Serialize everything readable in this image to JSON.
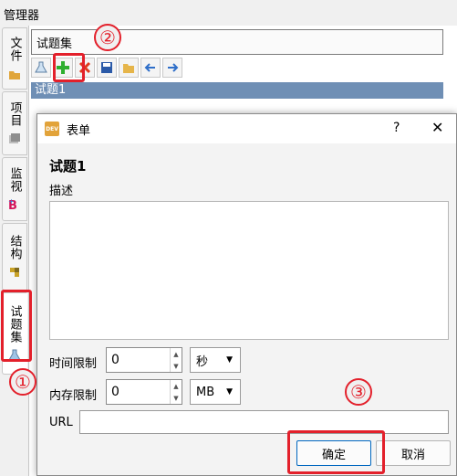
{
  "manager": {
    "title": "管理器"
  },
  "side_tabs": [
    {
      "label": "文件",
      "icon": "folder-icon"
    },
    {
      "label": "项目",
      "icon": "books-icon"
    },
    {
      "label": "监视",
      "icon": "watch-icon"
    },
    {
      "label": "结构",
      "icon": "puzzle-icon"
    },
    {
      "label": "试题集",
      "icon": "flask-icon",
      "active": true
    }
  ],
  "panel": {
    "collection_name": "试题集",
    "toolbar": [
      "flask-icon",
      "add-icon",
      "delete-icon",
      "save-icon",
      "open-folder-icon",
      "arrow-left-icon",
      "arrow-right-icon"
    ],
    "list_items": [
      "试题1"
    ]
  },
  "dialog": {
    "title": "表单",
    "help": "?",
    "close": "✕",
    "icon_text": "DEV",
    "question_title": "试题1",
    "description_label": "描述",
    "time_limit_label": "时间限制",
    "time_limit_value": "0",
    "time_unit": "秒",
    "memory_limit_label": "内存限制",
    "memory_limit_value": "0",
    "memory_unit": "MB",
    "url_label": "URL",
    "url_value": "",
    "ok_label": "确定",
    "cancel_label": "取消"
  },
  "annotations": {
    "marker_1": "①",
    "marker_2": "②",
    "marker_3": "③"
  },
  "colors": {
    "annotation": "#e3202b",
    "selection": "#6f8fb5"
  }
}
